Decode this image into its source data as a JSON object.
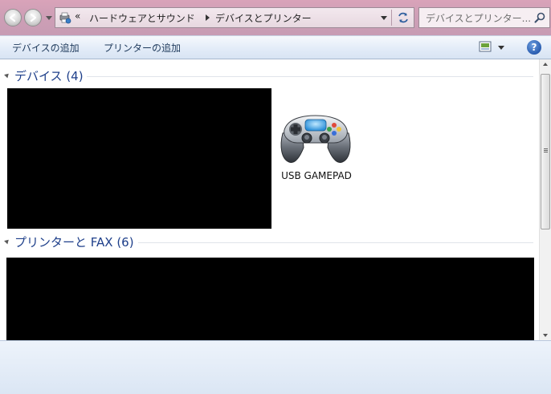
{
  "window": {
    "breadcrumb_overflow": "«",
    "breadcrumb": [
      "ハードウェアとサウンド",
      "デバイスとプリンター"
    ],
    "search_placeholder": "デバイスとプリンター..."
  },
  "commandbar": {
    "add_device": "デバイスの追加",
    "add_printer": "プリンターの追加",
    "help": "?"
  },
  "groups": [
    {
      "label": "デバイス (4)",
      "items": [
        {
          "label": "USB GAMEPAD",
          "icon": "gamepad-icon"
        }
      ]
    },
    {
      "label": "プリンターと FAX (6)",
      "items": []
    }
  ],
  "colors": {
    "titlebar": "#cf9fb6",
    "group_header": "#1e3f8a",
    "redacted": "#000000"
  }
}
